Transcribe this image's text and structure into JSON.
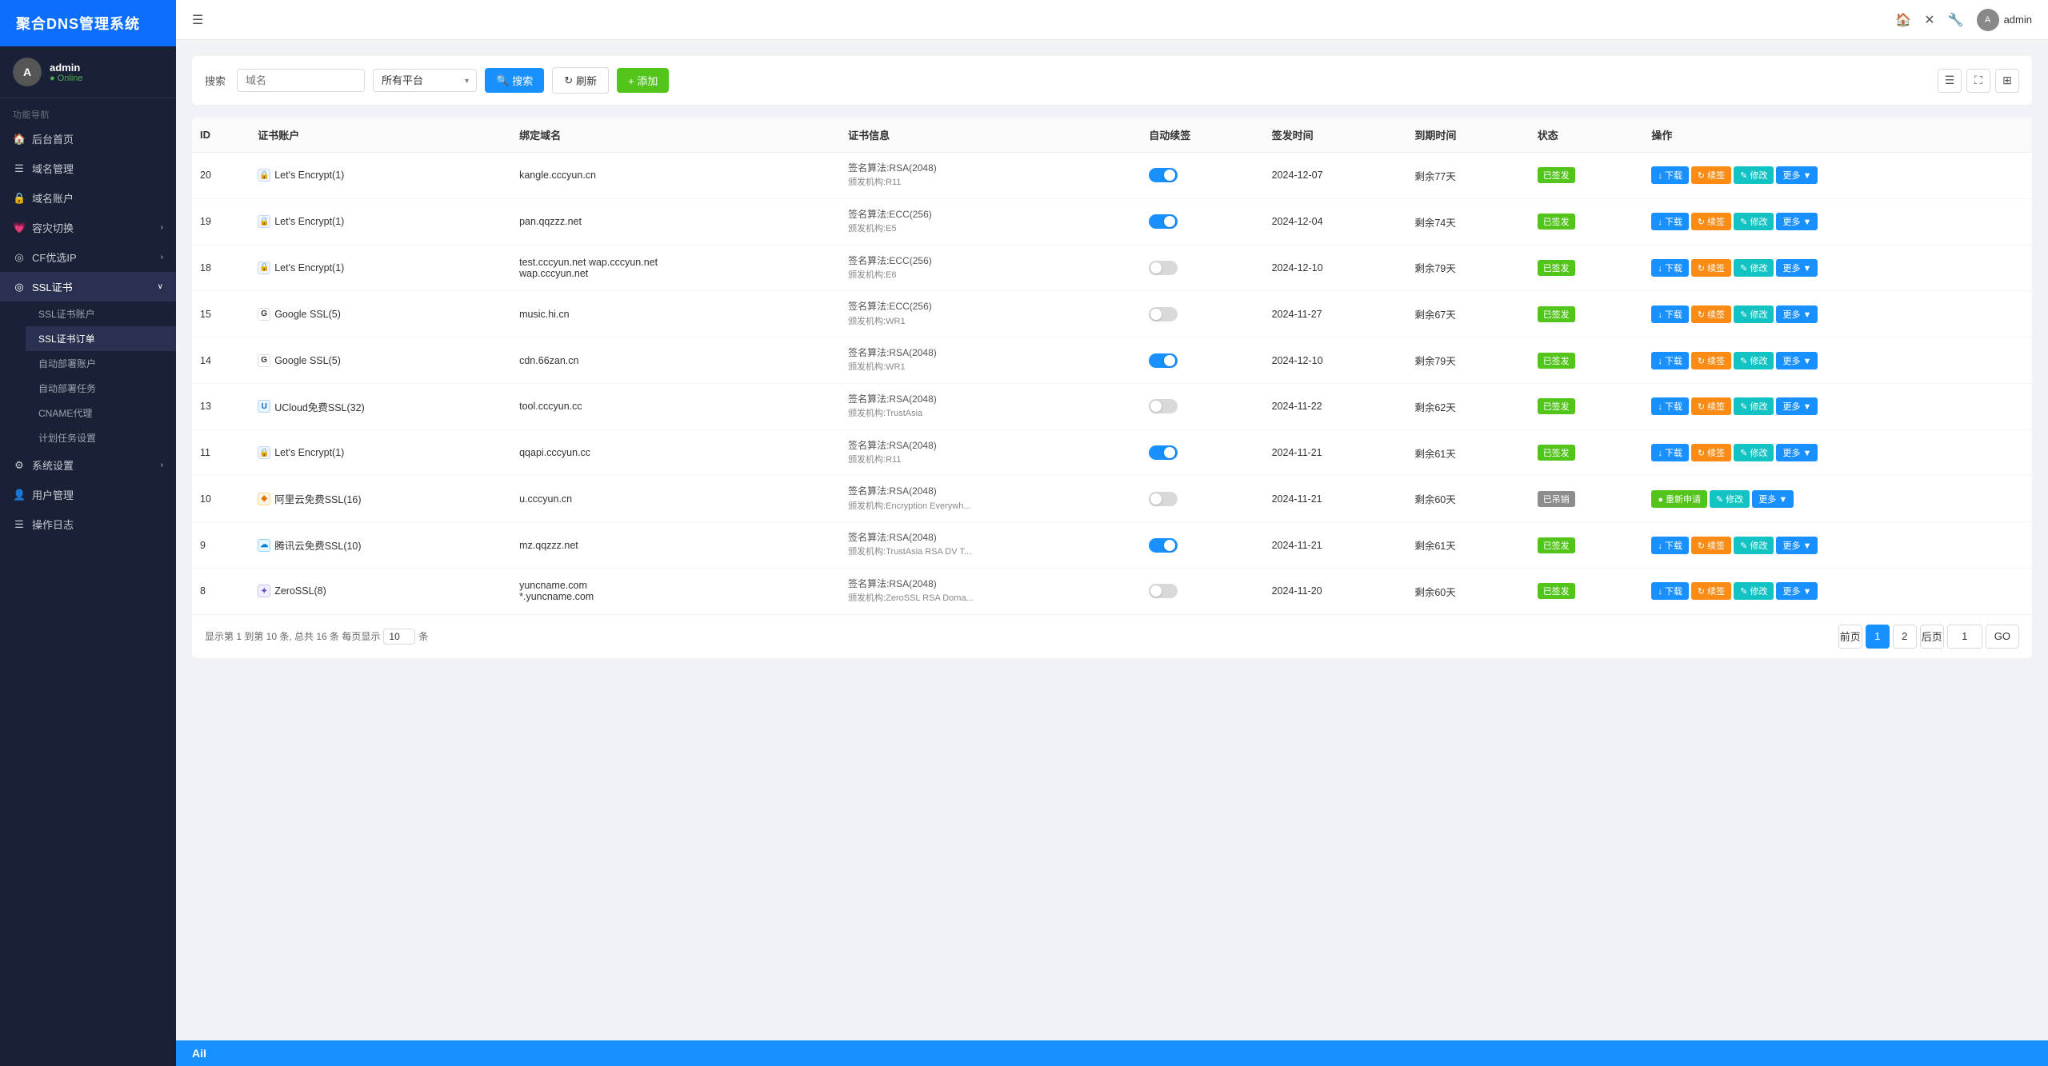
{
  "sidebar": {
    "logo": "聚合DNS管理系统",
    "user": {
      "name": "admin",
      "status": "Online",
      "initials": "A"
    },
    "section_label": "功能导航",
    "items": [
      {
        "id": "home",
        "label": "后台首页",
        "icon": "🏠",
        "has_arrow": false
      },
      {
        "id": "domain-mgmt",
        "label": "域名管理",
        "icon": "☰",
        "has_arrow": false
      },
      {
        "id": "domain-account",
        "label": "域名账户",
        "icon": "🔒",
        "has_arrow": false
      },
      {
        "id": "failover",
        "label": "容灾切换",
        "icon": "💗",
        "has_arrow": true
      },
      {
        "id": "cf-ip",
        "label": "CF优选IP",
        "icon": "◎",
        "has_arrow": true
      },
      {
        "id": "ssl",
        "label": "SSL证书",
        "icon": "◎",
        "has_arrow": true,
        "active": true
      },
      {
        "id": "ssl-account",
        "label": "SSL证书账户",
        "icon": "",
        "sub": true
      },
      {
        "id": "ssl-order",
        "label": "SSL证书订单",
        "icon": "",
        "sub": true,
        "active": true
      },
      {
        "id": "auto-deploy-account",
        "label": "自动部署账户",
        "icon": "",
        "sub": true
      },
      {
        "id": "auto-deploy-task",
        "label": "自动部署任务",
        "icon": "",
        "sub": true
      },
      {
        "id": "cname-proxy",
        "label": "CNAME代理",
        "icon": "",
        "sub": true
      },
      {
        "id": "scheduled-task",
        "label": "计划任务设置",
        "icon": "",
        "sub": true
      },
      {
        "id": "system-settings",
        "label": "系统设置",
        "icon": "⚙",
        "has_arrow": true
      },
      {
        "id": "user-mgmt",
        "label": "用户管理",
        "icon": "👤",
        "has_arrow": false
      },
      {
        "id": "operation-log",
        "label": "操作日志",
        "icon": "☰",
        "has_arrow": false
      }
    ]
  },
  "topbar": {
    "menu_icon": "☰",
    "home_icon": "🏠",
    "close_icon": "✕",
    "settings_icon": "🔧",
    "admin_label": "admin"
  },
  "toolbar": {
    "search_label": "搜索",
    "search_placeholder": "域名",
    "platform_placeholder": "所有平台",
    "platform_options": [
      "所有平台",
      "Let's Encrypt",
      "Google SSL",
      "UCloud免费SSL",
      "阿里云免费SSL",
      "腾讯云免费SSL",
      "ZeroSSL"
    ],
    "search_btn": "搜索",
    "refresh_btn": "刷新",
    "add_btn": "+ 添加"
  },
  "table": {
    "columns": [
      "ID",
      "证书账户",
      "绑定域名",
      "证书信息",
      "自动续签",
      "签发时间",
      "到期时间",
      "状态",
      "操作"
    ],
    "rows": [
      {
        "id": "20",
        "account_platform": "le",
        "account_name": "Let's Encrypt(1)",
        "domain": "kangle.cccyun.cn",
        "cert_algo": "签名算法:RSA(2048)",
        "cert_issuer": "颁发机构:R11",
        "auto_renew": true,
        "issue_date": "2024-12-07",
        "expire_text": "剩余77天",
        "status": "已签发",
        "status_type": "signed"
      },
      {
        "id": "19",
        "account_platform": "le",
        "account_name": "Let's Encrypt(1)",
        "domain": "pan.qqzzz.net",
        "cert_algo": "签名算法:ECC(256)",
        "cert_issuer": "颁发机构:E5",
        "auto_renew": true,
        "issue_date": "2024-12-04",
        "expire_text": "剩余74天",
        "status": "已签发",
        "status_type": "signed"
      },
      {
        "id": "18",
        "account_platform": "le",
        "account_name": "Let's Encrypt(1)",
        "domain": "test.cccyun.net\nwap.cccyun.net",
        "domain2": "wap.cccyun.net",
        "cert_algo": "签名算法:ECC(256)",
        "cert_issuer": "颁发机构:E6",
        "auto_renew": false,
        "issue_date": "2024-12-10",
        "expire_text": "剩余79天",
        "status": "已签发",
        "status_type": "signed"
      },
      {
        "id": "15",
        "account_platform": "google",
        "account_name": "Google SSL(5)",
        "domain": "music.hi.cn",
        "cert_algo": "签名算法:ECC(256)",
        "cert_issuer": "颁发机构:WR1",
        "auto_renew": false,
        "issue_date": "2024-11-27",
        "expire_text": "剩余67天",
        "status": "已签发",
        "status_type": "signed"
      },
      {
        "id": "14",
        "account_platform": "google",
        "account_name": "Google SSL(5)",
        "domain": "cdn.66zan.cn",
        "cert_algo": "签名算法:RSA(2048)",
        "cert_issuer": "颁发机构:WR1",
        "auto_renew": true,
        "issue_date": "2024-12-10",
        "expire_text": "剩余79天",
        "status": "已签发",
        "status_type": "signed"
      },
      {
        "id": "13",
        "account_platform": "ucloud",
        "account_name": "UCloud免费SSL(32)",
        "domain": "tool.cccyun.cc",
        "cert_algo": "签名算法:RSA(2048)",
        "cert_issuer": "颁发机构:TrustAsia",
        "auto_renew": false,
        "issue_date": "2024-11-22",
        "expire_text": "剩余62天",
        "status": "已签发",
        "status_type": "signed"
      },
      {
        "id": "11",
        "account_platform": "le",
        "account_name": "Let's Encrypt(1)",
        "domain": "qqapi.cccyun.cc",
        "cert_algo": "签名算法:RSA(2048)",
        "cert_issuer": "颁发机构:R11",
        "auto_renew": true,
        "issue_date": "2024-11-21",
        "expire_text": "剩余61天",
        "status": "已签发",
        "status_type": "signed"
      },
      {
        "id": "10",
        "account_platform": "aliyun",
        "account_name": "阿里云免费SSL(16)",
        "domain": "u.cccyun.cn",
        "cert_algo": "签名算法:RSA(2048)",
        "cert_issuer": "颁发机构:Encryption Everywh...",
        "auto_renew": false,
        "issue_date": "2024-11-21",
        "expire_text": "剩余60天",
        "status": "已吊销",
        "status_type": "suspended",
        "actions_special": true
      },
      {
        "id": "9",
        "account_platform": "tencent",
        "account_name": "腾讯云免费SSL(10)",
        "domain": "mz.qqzzz.net",
        "cert_algo": "签名算法:RSA(2048)",
        "cert_issuer": "颁发机构:TrustAsia RSA DV T...",
        "auto_renew": true,
        "issue_date": "2024-11-21",
        "expire_text": "剩余61天",
        "status": "已签发",
        "status_type": "signed"
      },
      {
        "id": "8",
        "account_platform": "zero",
        "account_name": "ZeroSSL(8)",
        "domain": "yuncname.com",
        "domain2": "*.yuncname.com",
        "cert_algo": "签名算法:RSA(2048)",
        "cert_issuer": "颁发机构:ZeroSSL RSA Doma...",
        "auto_renew": false,
        "issue_date": "2024-11-20",
        "expire_text": "剩余60天",
        "status": "已签发",
        "status_type": "signed"
      }
    ],
    "action_btns": {
      "download": "下载",
      "renew": "续签",
      "edit": "修改",
      "more": "更多",
      "reapply": "重新申请"
    }
  },
  "pagination": {
    "info": "显示第 1 到第 10 条, 总共 16 条 每页显示",
    "per_page": "10",
    "per_page_suffix": "条",
    "prev": "前页",
    "next": "后页",
    "current_page": "1",
    "page2": "2",
    "go_label": "GO",
    "page_input": "1"
  },
  "bottom_bar": {
    "text": "AiI"
  }
}
